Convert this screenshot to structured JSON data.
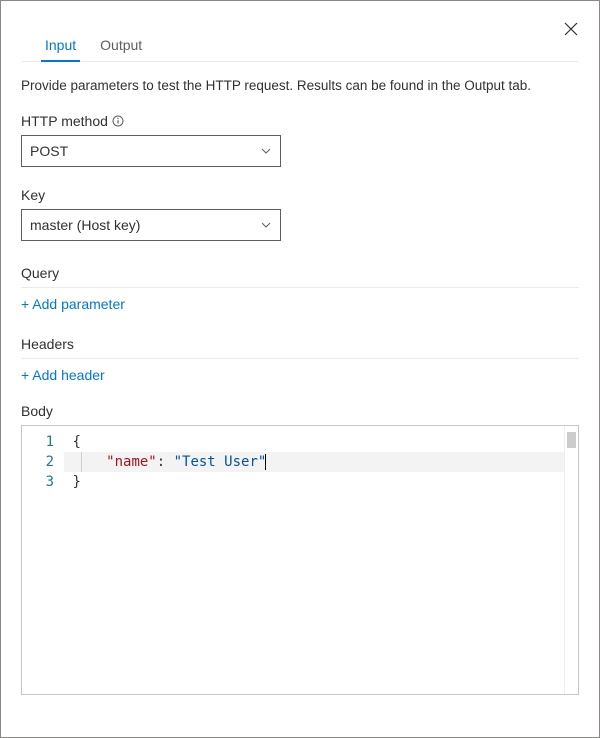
{
  "tabs": {
    "input": "Input",
    "output": "Output"
  },
  "description": "Provide parameters to test the HTTP request. Results can be found in the Output tab.",
  "http_method": {
    "label": "HTTP method",
    "value": "POST"
  },
  "key": {
    "label": "Key",
    "value": "master (Host key)"
  },
  "query": {
    "label": "Query",
    "add": "+ Add parameter"
  },
  "headers": {
    "label": "Headers",
    "add": "+ Add header"
  },
  "body": {
    "label": "Body",
    "lines": {
      "l1": "1",
      "l2": "2",
      "l3": "3"
    },
    "code": {
      "open": "{",
      "key": "\"name\"",
      "colon": ": ",
      "value": "\"Test User\"",
      "close": "}"
    }
  }
}
